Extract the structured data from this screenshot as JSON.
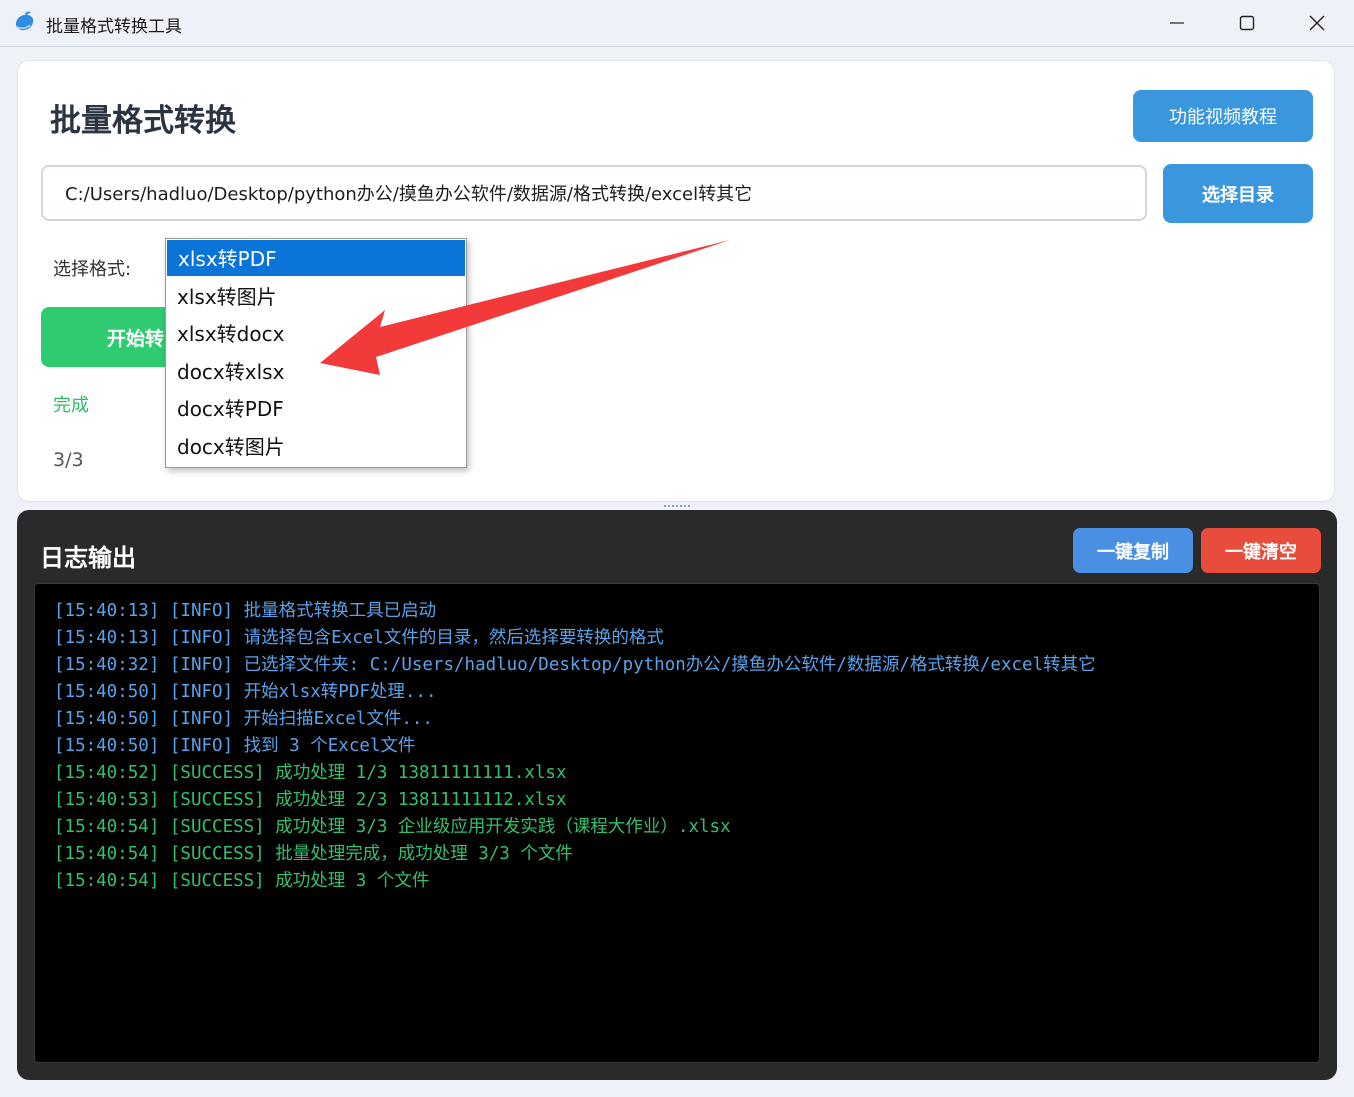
{
  "window": {
    "title": "批量格式转换工具"
  },
  "header": {
    "title": "批量格式转换",
    "tutorial_button": "功能视频教程"
  },
  "directory": {
    "path": "C:/Users/hadluo/Desktop/python办公/摸鱼办公软件/数据源/格式转换/excel转其它",
    "select_button": "选择目录"
  },
  "format": {
    "label": "选择格式:",
    "options": [
      "xlsx转PDF",
      "xlsx转图片",
      "xlsx转docx",
      "docx转xlsx",
      "docx转PDF",
      "docx转图片"
    ],
    "selected": "xlsx转PDF"
  },
  "start_button": "开始转",
  "status": "完成",
  "progress": "3/3",
  "log": {
    "title": "日志输出",
    "copy_button": "一键复制",
    "clear_button": "一键清空",
    "lines": [
      {
        "text": "[15:40:13] [INFO] 批量格式转换工具已启动",
        "level": "info"
      },
      {
        "text": "[15:40:13] [INFO] 请选择包含Excel文件的目录，然后选择要转换的格式",
        "level": "info"
      },
      {
        "text": "[15:40:32] [INFO] 已选择文件夹: C:/Users/hadluo/Desktop/python办公/摸鱼办公软件/数据源/格式转换/excel转其它",
        "level": "info"
      },
      {
        "text": "[15:40:50] [INFO] 开始xlsx转PDF处理...",
        "level": "info"
      },
      {
        "text": "[15:40:50] [INFO] 开始扫描Excel文件...",
        "level": "info"
      },
      {
        "text": "[15:40:50] [INFO] 找到 3 个Excel文件",
        "level": "info"
      },
      {
        "text": "[15:40:52] [SUCCESS] 成功处理 1/3 13811111111.xlsx",
        "level": "success"
      },
      {
        "text": "[15:40:53] [SUCCESS] 成功处理 2/3 13811111112.xlsx",
        "level": "success"
      },
      {
        "text": "[15:40:54] [SUCCESS] 成功处理 3/3 企业级应用开发实践（课程大作业）.xlsx",
        "level": "success"
      },
      {
        "text": "[15:40:54] [SUCCESS] 批量处理完成，成功处理 3/3 个文件",
        "level": "success"
      },
      {
        "text": "[15:40:54] [SUCCESS] 成功处理 3 个文件",
        "level": "success"
      }
    ]
  },
  "colors": {
    "accent_blue": "#3a97de",
    "start_green": "#2fcb71",
    "clear_red": "#e74c3c",
    "copy_blue": "#4a90e2",
    "info_text": "#5aa2ea",
    "success_text": "#33c06d",
    "annotation_arrow": "#f23a3a"
  }
}
